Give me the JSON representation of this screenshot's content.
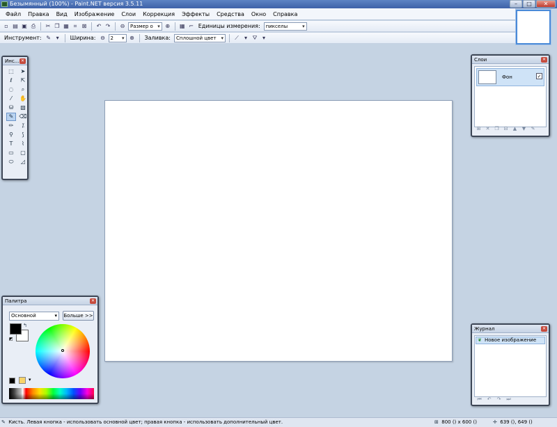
{
  "window": {
    "title": "Безымянный (100%) - Paint.NET версия 3.5.11",
    "minimize": "–",
    "maximize": "□",
    "close": "✕"
  },
  "menu": [
    "Файл",
    "Правка",
    "Вид",
    "Изображение",
    "Слои",
    "Коррекция",
    "Эффекты",
    "Средства",
    "Окно",
    "Справка"
  ],
  "toolbar1": {
    "zoom_combo": "Размер о",
    "units_label": "Единицы измерения:",
    "units_value": "пикселы"
  },
  "toolbar2": {
    "tool_label": "Инструмент:",
    "width_label": "Ширина:",
    "width_value": "2",
    "fill_label": "Заливка:",
    "fill_value": "Сплошной цвет"
  },
  "tools_window": {
    "title": "Инс..."
  },
  "layers_window": {
    "title": "Слои",
    "layers": [
      {
        "name": "Фон",
        "visible": true
      }
    ]
  },
  "palette_window": {
    "title": "Палитра",
    "mode": "Основной",
    "more_button": "Больше >>",
    "primary_color": "#000000",
    "secondary_color": "#ffffff"
  },
  "history_window": {
    "title": "Журнал",
    "items": [
      "Новое изображение"
    ]
  },
  "status": {
    "hint": "Кисть. Левая кнопка - использовать основной цвет; правая кнопка - использовать дополнительный цвет.",
    "image_size": "800 () x 600 ()",
    "cursor_pos": "639 (), 649 ()"
  }
}
